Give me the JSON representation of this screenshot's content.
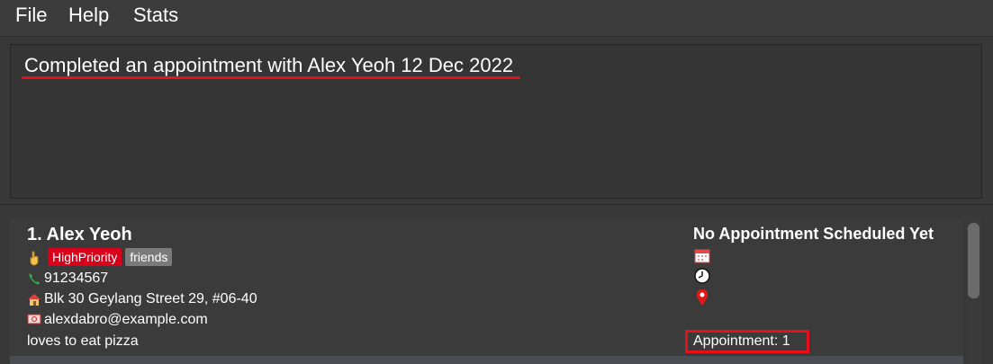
{
  "menu": {
    "file": "File",
    "help": "Help",
    "stats": "Stats"
  },
  "result": {
    "message": "Completed an appointment with Alex Yeoh 12 Dec 2022"
  },
  "person": {
    "index_name": "1.  Alex Yeoh",
    "tags": [
      "HighPriority",
      "friends"
    ],
    "phone": "91234567",
    "address": "Blk 30 Geylang Street 29, #06-40",
    "email": "alexdabro@example.com",
    "description": "loves to eat pizza",
    "appointment_status": "No Appointment Scheduled Yet",
    "appointment_count": "Appointment: 1"
  },
  "colors": {
    "highlight": "#e8101a",
    "high_priority_tag": "#d9001b",
    "friends_tag": "#7a7a7a"
  },
  "icons": [
    "hand-icon",
    "phone-icon",
    "house-icon",
    "email-icon",
    "calendar-icon",
    "clock-icon",
    "location-pin-icon"
  ]
}
